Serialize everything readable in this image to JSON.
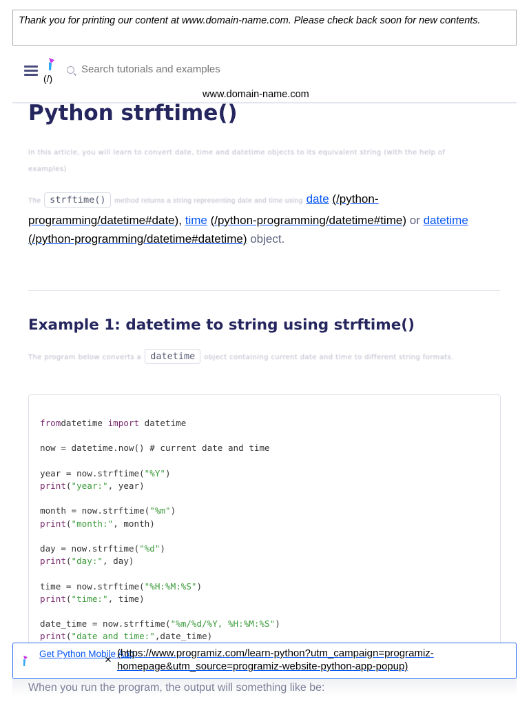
{
  "print_notice": "Thank you for printing our content at www.domain-name.com. Please check back soon for new contents.",
  "header": {
    "logo_link": "(/)",
    "search_placeholder": "Search tutorials and examples",
    "domain": "www.domain-name.com"
  },
  "article": {
    "title": "Python strftime()",
    "intro": "In this article, you will learn to convert date, time and datetime objects to its equivalent string (with the help of examples)",
    "para2": {
      "before": "The",
      "code": "strftime()",
      "middle": "method returns a string representing date and time using",
      "link1": "date",
      "link1_href": "(/python-programming/datetime#date)",
      "link2": "time",
      "link2_href": "(/python-programming/datetime#time)",
      "or": "or",
      "link3": "datetime",
      "link3_href": "(/python-programming/datetime#datetime)",
      "end": "object."
    },
    "example1": {
      "heading": "Example 1: datetime to string using strftime()",
      "before": "The program below converts a",
      "code": "datetime",
      "after": "object containing current date and time to different string formats."
    },
    "code_lines": [
      [
        [
          "kw",
          "from"
        ],
        [
          "",
          "datetime "
        ],
        [
          "kw",
          "import"
        ],
        [
          "",
          " datetime"
        ]
      ],
      [],
      [
        [
          "",
          "now = datetime.now() # current date and time"
        ]
      ],
      [],
      [
        [
          "",
          "year = now.strftime("
        ],
        [
          "str",
          "\"%Y\""
        ],
        [
          "",
          ")"
        ]
      ],
      [
        [
          "kw",
          "print"
        ],
        [
          "",
          "("
        ],
        [
          "str",
          "\"year:\""
        ],
        [
          "",
          ", year)"
        ]
      ],
      [],
      [
        [
          "",
          "month = now.strftime("
        ],
        [
          "str",
          "\"%m\""
        ],
        [
          "",
          ")"
        ]
      ],
      [
        [
          "kw",
          "print"
        ],
        [
          "",
          "("
        ],
        [
          "str",
          "\"month:\""
        ],
        [
          "",
          ", month)"
        ]
      ],
      [],
      [
        [
          "",
          "day = now.strftime("
        ],
        [
          "str",
          "\"%d\""
        ],
        [
          "",
          ")"
        ]
      ],
      [
        [
          "kw",
          "print"
        ],
        [
          "",
          "("
        ],
        [
          "str",
          "\"day:\""
        ],
        [
          "",
          ", day)"
        ]
      ],
      [],
      [
        [
          "",
          "time = now.strftime("
        ],
        [
          "str",
          "\"%H:%M:%S\""
        ],
        [
          "",
          ")"
        ]
      ],
      [
        [
          "kw",
          "print"
        ],
        [
          "",
          "("
        ],
        [
          "str",
          "\"time:\""
        ],
        [
          "",
          ", time)"
        ]
      ],
      [],
      [
        [
          "",
          "date_time = now.strftime("
        ],
        [
          "str",
          "\"%m/%d/%Y, %H:%M:%S\""
        ],
        [
          "",
          ")"
        ]
      ],
      [
        [
          "kw",
          "print"
        ],
        [
          "",
          "("
        ],
        [
          "str",
          "\"date and time:\""
        ],
        [
          "",
          ",date_time)"
        ]
      ]
    ],
    "after_code": "When you run the program, the output will something like be:"
  },
  "app_banner": {
    "label": "Get Python Mobile App",
    "close": "×",
    "url": "(https://www.programiz.com/learn-python?utm_campaign=programiz-homepage&utm_source=programiz-website-python-app-popup)"
  },
  "colors": {
    "heading": "#25265e",
    "link": "#0556f3",
    "keyword": "#7a2a6e",
    "string": "#3a9a3a",
    "banner_border": "#2f6ff5"
  }
}
